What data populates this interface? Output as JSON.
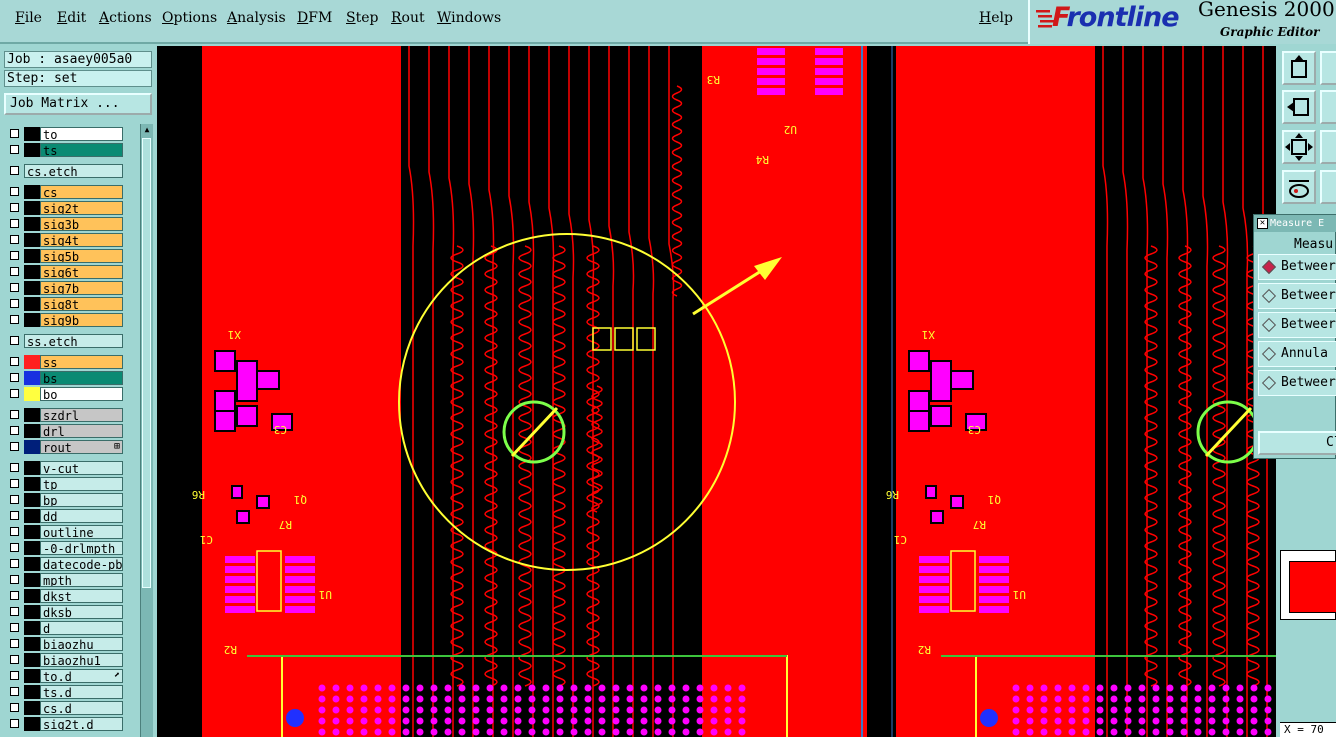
{
  "menu": [
    "File",
    "Edit",
    "Actions",
    "Options",
    "Analysis",
    "DFM",
    "Step",
    "Rout",
    "Windows"
  ],
  "help": "Help",
  "brand": {
    "logo": "Frontline",
    "product": "Genesis 2000",
    "subtitle": "Graphic Editor"
  },
  "job": {
    "job_line": "Job : asaey005a0",
    "step_line": "Step: set",
    "matrix_button": "Job Matrix ..."
  },
  "layers": [
    {
      "name": "to",
      "style": "plain",
      "swatch": "#000000"
    },
    {
      "name": "ts",
      "style": "sel",
      "swatch": "#000000"
    },
    {
      "name": "cs.etch",
      "style": "misc",
      "swatch": "",
      "gap": true
    },
    {
      "name": "cs",
      "style": "sig",
      "swatch": "#000000",
      "gap": true
    },
    {
      "name": "sig2t",
      "style": "sig",
      "swatch": "#000000"
    },
    {
      "name": "sig3b",
      "style": "sig",
      "swatch": "#000000"
    },
    {
      "name": "sig4t",
      "style": "sig",
      "swatch": "#000000"
    },
    {
      "name": "sig5b",
      "style": "sig",
      "swatch": "#000000"
    },
    {
      "name": "sig6t",
      "style": "sig",
      "swatch": "#000000"
    },
    {
      "name": "sig7b",
      "style": "sig",
      "swatch": "#000000"
    },
    {
      "name": "sig8t",
      "style": "sig",
      "swatch": "#000000"
    },
    {
      "name": "sig9b",
      "style": "sig",
      "swatch": "#000000"
    },
    {
      "name": "ss.etch",
      "style": "misc",
      "swatch": "",
      "gap": true
    },
    {
      "name": "ss",
      "style": "sig",
      "swatch": "#ff2020",
      "gap": true
    },
    {
      "name": "bs",
      "style": "sel",
      "swatch": "#1830e0"
    },
    {
      "name": "bo",
      "style": "plain",
      "swatch": "#ffff40"
    },
    {
      "name": "szdrl",
      "style": "drl",
      "swatch": "#000000",
      "gap": true
    },
    {
      "name": "drl",
      "style": "drl",
      "swatch": "#000000"
    },
    {
      "name": "rout",
      "style": "drl",
      "swatch": "#000000",
      "mark": "⊞",
      "navy": true
    },
    {
      "name": "v-cut",
      "style": "misc",
      "swatch": "#000000",
      "gap": true
    },
    {
      "name": "tp",
      "style": "misc",
      "swatch": "#000000"
    },
    {
      "name": "bp",
      "style": "misc",
      "swatch": "#000000"
    },
    {
      "name": "dd",
      "style": "misc",
      "swatch": "#000000"
    },
    {
      "name": "outline",
      "style": "misc",
      "swatch": "#000000"
    },
    {
      "name": "-0-drlmpth",
      "style": "misc",
      "swatch": "#000000"
    },
    {
      "name": "datecode-pbe",
      "style": "misc",
      "swatch": "#000000"
    },
    {
      "name": "mpth",
      "style": "misc",
      "swatch": "#000000"
    },
    {
      "name": "dkst",
      "style": "misc",
      "swatch": "#000000"
    },
    {
      "name": "dksb",
      "style": "misc",
      "swatch": "#000000"
    },
    {
      "name": "d",
      "style": "misc",
      "swatch": "#000000"
    },
    {
      "name": "biaozhu",
      "style": "misc",
      "swatch": "#000000"
    },
    {
      "name": "biaozhu1",
      "style": "misc",
      "swatch": "#000000"
    },
    {
      "name": "to.d",
      "style": "misc",
      "swatch": "#000000",
      "mark": "⬈"
    },
    {
      "name": "ts.d",
      "style": "misc",
      "swatch": "#000000"
    },
    {
      "name": "cs.d",
      "style": "misc",
      "swatch": "#000000"
    },
    {
      "name": "sig2t.d",
      "style": "misc",
      "swatch": "#000000"
    }
  ],
  "measure": {
    "title": "Measure E",
    "heading": "Measu",
    "options": [
      {
        "label": "Betweer",
        "selected": true
      },
      {
        "label": "Betweer",
        "selected": false
      },
      {
        "label": "Betweer",
        "selected": false
      },
      {
        "label": "Annula",
        "selected": false
      },
      {
        "label": "Betweer",
        "selected": false
      }
    ],
    "button": "Cl"
  },
  "canvas": {
    "labels": [
      "X1",
      "C3",
      "Q1",
      "R6",
      "R7",
      "U1",
      "U2",
      "R2",
      "R4",
      "R3",
      "C1"
    ],
    "colors": {
      "copper": "#ff0000",
      "trace": "#ff0000",
      "pad": "#ff00ff",
      "silk": "#ffff33",
      "outline": "#3cc43c",
      "bg": "#000000",
      "via": "#2030ff"
    }
  },
  "coord": "X = 70"
}
